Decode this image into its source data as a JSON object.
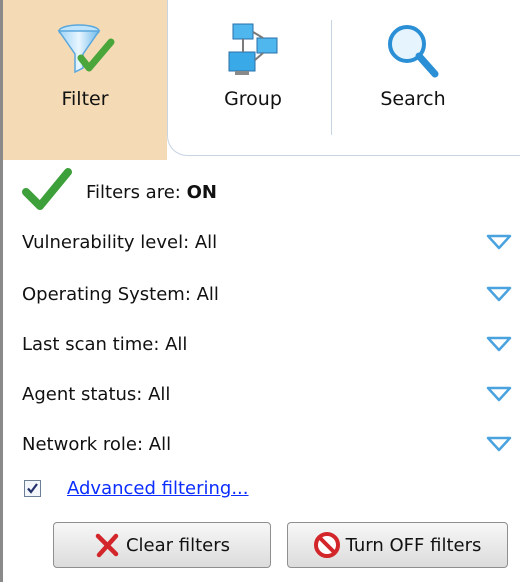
{
  "tabs": [
    {
      "label": "Filter",
      "icon": "funnel-check-icon",
      "active": true
    },
    {
      "label": "Group",
      "icon": "network-computers-icon",
      "active": false
    },
    {
      "label": "Search",
      "icon": "magnifier-icon",
      "active": false
    }
  ],
  "status": {
    "prefix": "Filters are: ",
    "state": "ON",
    "icon": "green-check-icon"
  },
  "filters": [
    {
      "label": "Vulnerability level: All"
    },
    {
      "label": "Operating System: All"
    },
    {
      "label": "Last scan time: All"
    },
    {
      "label": "Agent status: All"
    },
    {
      "label": "Network role: All"
    }
  ],
  "advanced": {
    "label": "Advanced filtering...",
    "checked": true
  },
  "buttons": {
    "clear": "Clear filters",
    "turn_off": "Turn OFF filters"
  },
  "colors": {
    "active_tab": "#f4dbb6",
    "link": "#0b2dff",
    "chevron": "#4aa3df",
    "check": "#3ea03a"
  }
}
